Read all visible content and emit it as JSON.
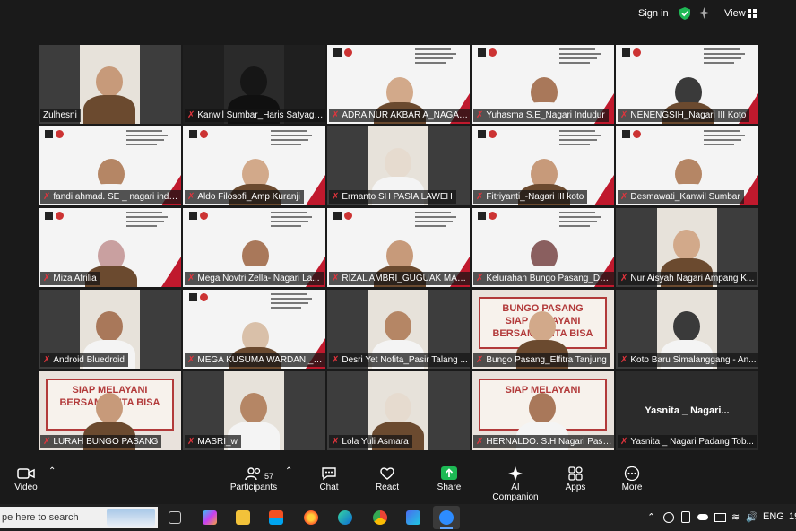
{
  "header": {
    "sign_in": "Sign in",
    "view": "View",
    "icons": [
      "shield-check-icon",
      "sparkle-icon",
      "grid-icon"
    ]
  },
  "participants": [
    {
      "name": "Zulhesni",
      "muted": false,
      "active": true,
      "kind": "camera"
    },
    {
      "name": "Kanwil Sumbar_Haris Satyagr...",
      "muted": true,
      "kind": "camera-dark"
    },
    {
      "name": "ADRA NUR AKBAR A_NAGARI ...",
      "muted": true,
      "kind": "slide"
    },
    {
      "name": "Yuhasma S.E_Nagari Indudur",
      "muted": true,
      "kind": "slide"
    },
    {
      "name": "NENENGSIH_Nagari III Koto",
      "muted": true,
      "kind": "slide"
    },
    {
      "name": "fandi ahmad. SE _ nagari indu...",
      "muted": true,
      "kind": "slide"
    },
    {
      "name": "Aldo Filosofi_Amp Kuranji",
      "muted": true,
      "kind": "slide"
    },
    {
      "name": "Ermanto SH PASIA LAWEH",
      "muted": true,
      "kind": "camera"
    },
    {
      "name": "Fitriyanti_-Nagari III koto",
      "muted": true,
      "kind": "slide"
    },
    {
      "name": "Desmawati_Kanwil Sumbar",
      "muted": true,
      "kind": "slide"
    },
    {
      "name": "Miza Afrilia",
      "muted": true,
      "kind": "slide"
    },
    {
      "name": "Mega Novtri Zella- Nagari La...",
      "muted": true,
      "kind": "slide"
    },
    {
      "name": "RIZAL AMBRI_GUGUAK MALA...",
      "muted": true,
      "kind": "slide"
    },
    {
      "name": "Kelurahan Bungo Pasang_Dev...",
      "muted": true,
      "kind": "slide"
    },
    {
      "name": "Nur Aisyah Nagari Ampang K...",
      "muted": true,
      "kind": "camera"
    },
    {
      "name": "Android Bluedroid",
      "muted": true,
      "kind": "camera"
    },
    {
      "name": "MEGA KUSUMA WARDANI_D...",
      "muted": true,
      "kind": "slide"
    },
    {
      "name": "Desri Yet Nofita_Pasir Talang ...",
      "muted": true,
      "kind": "camera"
    },
    {
      "name": "Bungo Pasang_Elfitra Tanjung",
      "muted": true,
      "kind": "banner",
      "banner_text": [
        "BUNGO PASANG",
        "SIAP MELAYANI",
        "BERSAMA KITA BISA"
      ]
    },
    {
      "name": "Koto Baru Simalanggang - An...",
      "muted": true,
      "kind": "camera"
    },
    {
      "name": "LURAH BUNGO PASANG",
      "muted": true,
      "kind": "banner",
      "banner_text": [
        "SIAP MELAYANI",
        "BERSAMA KITA BISA"
      ]
    },
    {
      "name": "MASRI_w",
      "muted": true,
      "kind": "camera"
    },
    {
      "name": "Lola Yuli Asmara",
      "muted": true,
      "kind": "camera"
    },
    {
      "name": "HERNALDO. S.H Nagari Pasia...",
      "muted": true,
      "kind": "banner",
      "banner_text": [
        "SIAP MELAYANI"
      ]
    },
    {
      "name": "Yasnita _ Nagari Padang Tob...",
      "muted": true,
      "kind": "no-video",
      "display_name": "Yasnita _ Nagari..."
    }
  ],
  "toolbar": {
    "video": "Video",
    "participants": "Participants",
    "participants_count": "57",
    "chat": "Chat",
    "react": "React",
    "share": "Share",
    "ai_companion": "AI Companion",
    "apps": "Apps",
    "more": "More",
    "share_color": "#1db954"
  },
  "taskbar": {
    "search_placeholder": "pe here to search",
    "language": "ENG",
    "clock_fragment": "19",
    "apps": [
      "task-view-icon",
      "copilot-icon",
      "file-explorer-icon",
      "store-icon",
      "firefox-icon",
      "edge-icon",
      "chrome-icon",
      "m365-icon",
      "zoom-icon"
    ]
  }
}
